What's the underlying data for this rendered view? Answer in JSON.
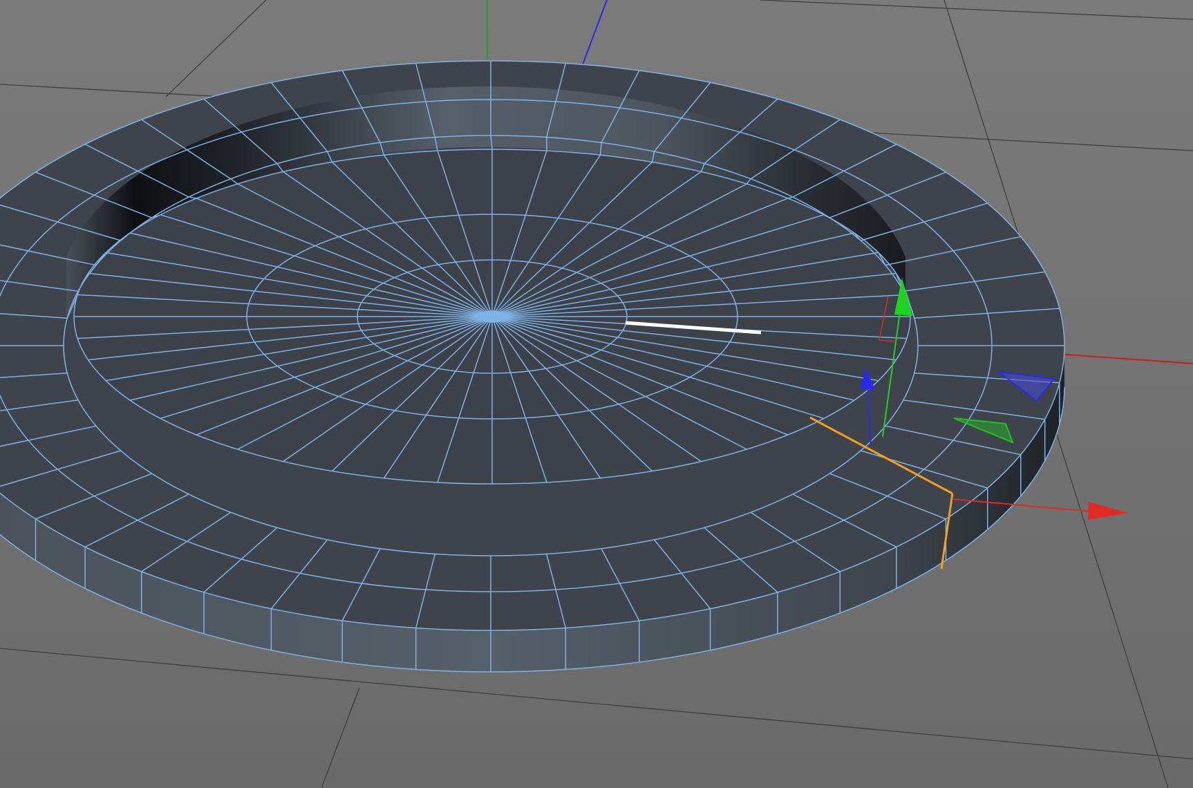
{
  "viewport": {
    "view": "perspective",
    "background_color": "#747474",
    "grid_color": "#3e3e3e",
    "grid_visible": true
  },
  "object": {
    "shape": "tube",
    "mode": "polygon-edit",
    "face_color": "#3f444c",
    "wire_color": "#7fb2e6",
    "segments": 48,
    "rings": 4
  },
  "axes": {
    "x_color": "#e02a22",
    "y_color": "#1fc21f",
    "z_color": "#2a2aee"
  },
  "selection": {
    "selected_edge_color": "#f0a020",
    "highlight_edge_color": "#ffffff"
  },
  "gizmo": {
    "type": "move-tool"
  }
}
